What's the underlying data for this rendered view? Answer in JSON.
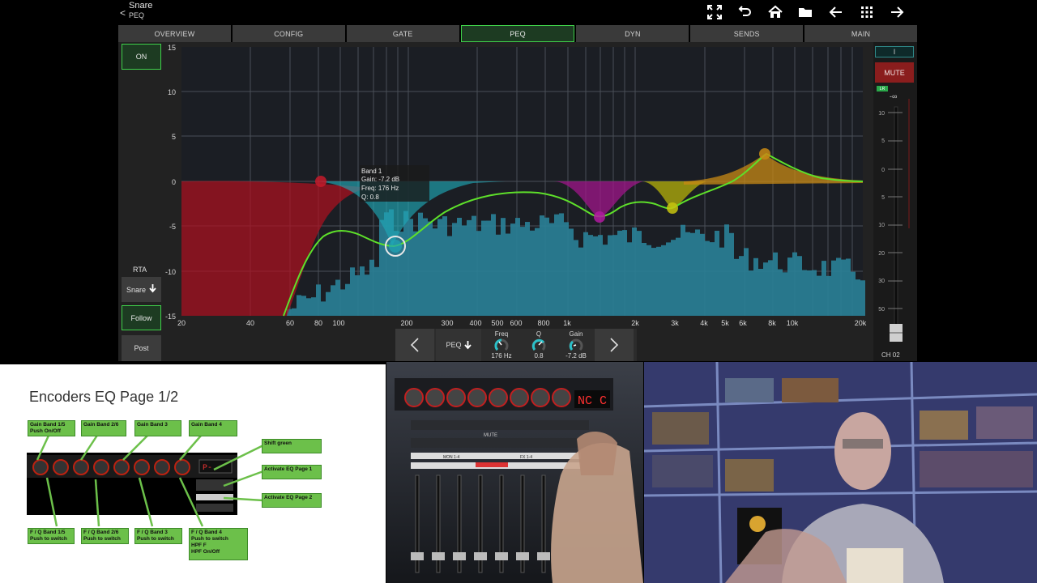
{
  "header": {
    "channel_name": "Snare",
    "page_name": "PEQ",
    "back_glyph": "<",
    "icons": [
      "fullscreen-icon",
      "undo-icon",
      "home-icon",
      "folder-icon",
      "arrow-left-icon",
      "grid-icon",
      "arrow-right-icon"
    ]
  },
  "tabs": [
    {
      "label": "OVERVIEW",
      "active": false
    },
    {
      "label": "CONFIG",
      "active": false
    },
    {
      "label": "GATE",
      "active": false
    },
    {
      "label": "PEQ",
      "active": true
    },
    {
      "label": "DYN",
      "active": false
    },
    {
      "label": "SENDS",
      "active": false
    },
    {
      "label": "MAIN",
      "active": false
    }
  ],
  "left_controls": {
    "on_label": "ON",
    "rta_label": "RTA",
    "snare_label": "Snare",
    "follow_label": "Follow",
    "post_label": "Post"
  },
  "eq_graph": {
    "y_ticks": [
      "15",
      "10",
      "5",
      "0",
      "-5",
      "-10",
      "-15"
    ],
    "x_ticks": [
      "20",
      "40",
      "60",
      "80",
      "100",
      "200",
      "300",
      "400",
      "500",
      "600",
      "800",
      "1k",
      "2k",
      "3k",
      "4k",
      "5k",
      "6k",
      "8k",
      "10k",
      "20k"
    ],
    "tooltip": {
      "line1": "Band 1",
      "line2": "Gain: -7.2 dB",
      "line3": "Freq: 176 Hz",
      "line4": "Q: 0.8"
    },
    "colors": {
      "band1": "#1fa7b5",
      "band_low": "#b01020",
      "band_mid": "#a0168a",
      "band_high_mid": "#b5b20a",
      "band_high": "#c88a14",
      "curve": "#5ee02a",
      "rta": "#2a7f95"
    }
  },
  "meter": {
    "top_label": "I",
    "mute_label": "MUTE",
    "lr_badge": "LR",
    "fader_level": "-∞",
    "scale": [
      "10",
      "5",
      "0",
      "5",
      "10",
      "20",
      "30",
      "50"
    ],
    "channel": "CH 02"
  },
  "encoder_strip": {
    "prev_glyph": "<",
    "next_glyph": ">",
    "page_label": "PEQ",
    "knobs": [
      {
        "name": "Freq",
        "value": "176 Hz"
      },
      {
        "name": "Q",
        "value": "0.8"
      },
      {
        "name": "Gain",
        "value": "-7.2 dB"
      }
    ]
  },
  "slide": {
    "title": "Encoders EQ Page 1/2",
    "device_display": "P-",
    "labels": {
      "gain15": [
        "Gain Band 1/5",
        "Push On/Off"
      ],
      "gain26": [
        "Gain Band 2/6"
      ],
      "gain3": [
        "Gain Band 3"
      ],
      "gain4": [
        "Gain Band 4"
      ],
      "shift": [
        "Shift green"
      ],
      "act1": [
        "Activate EQ Page 1"
      ],
      "act2": [
        "Activate EQ Page 2"
      ],
      "fq15": [
        "F / Q Band 1/5",
        "Push to switch"
      ],
      "fq26": [
        "F / Q Band 2/6",
        "Push to switch"
      ],
      "fq3": [
        "F / Q Band 3",
        "Push to switch"
      ],
      "fq4": [
        "F / Q Band 4",
        "Push to switch",
        "HPF F",
        "HPF On/Off"
      ]
    }
  },
  "video_console": {
    "display_text": "NC C",
    "strip_labels": [
      "MUTE",
      "MON 1-4",
      "FX 1-4"
    ]
  }
}
